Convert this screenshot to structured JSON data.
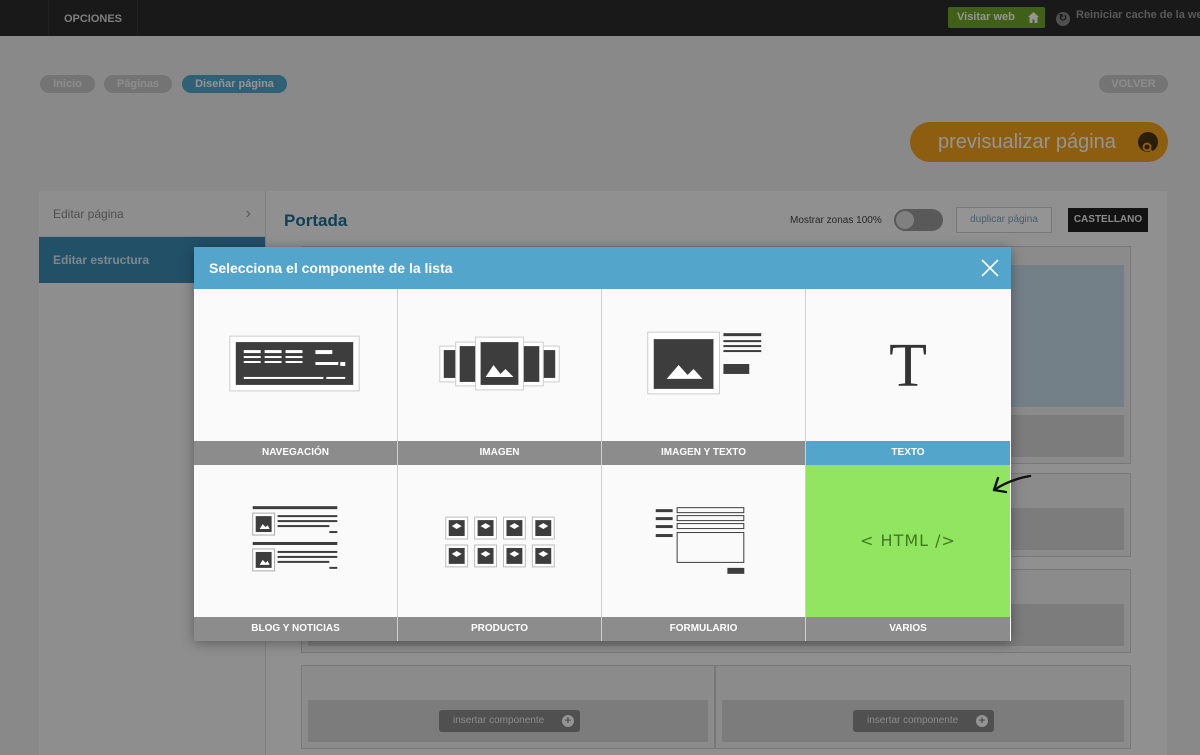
{
  "topbar": {
    "opciones": "OPCIONES",
    "visitar_web": "Visitar web",
    "reiniciar": "Reiniciar cache de la web"
  },
  "breadcrumb": [
    "Inicio",
    "Páginas",
    "Diseñar página"
  ],
  "volver": "VOLVER",
  "preview_label": "previsualizar página",
  "sidebar": {
    "items": [
      {
        "label": "Editar página"
      },
      {
        "label": "Editar estructura"
      }
    ]
  },
  "page": {
    "title": "Portada",
    "mostrar_zonas": "Mostrar zonas 100%",
    "duplicar": "duplicar página",
    "language": "CASTELLANO",
    "insert_label": "insertar componente"
  },
  "modal": {
    "title": "Selecciona el componente de la lista",
    "components": [
      {
        "label": "NAVEGACIÓN"
      },
      {
        "label": "IMAGEN"
      },
      {
        "label": "IMAGEN Y TEXTO"
      },
      {
        "label": "TEXTO"
      },
      {
        "label": "BLOG Y NOTICIAS"
      },
      {
        "label": "PRODUCTO"
      },
      {
        "label": "FORMULARIO"
      },
      {
        "label": "VARIOS"
      }
    ],
    "text_glyph": "T",
    "html_glyph": "< HTML />"
  },
  "colors": {
    "accent_blue": "#53a5cc",
    "visitar_green": "#6fa62a",
    "preview_orange": "#f3a11c",
    "varios_green": "#92e561"
  }
}
